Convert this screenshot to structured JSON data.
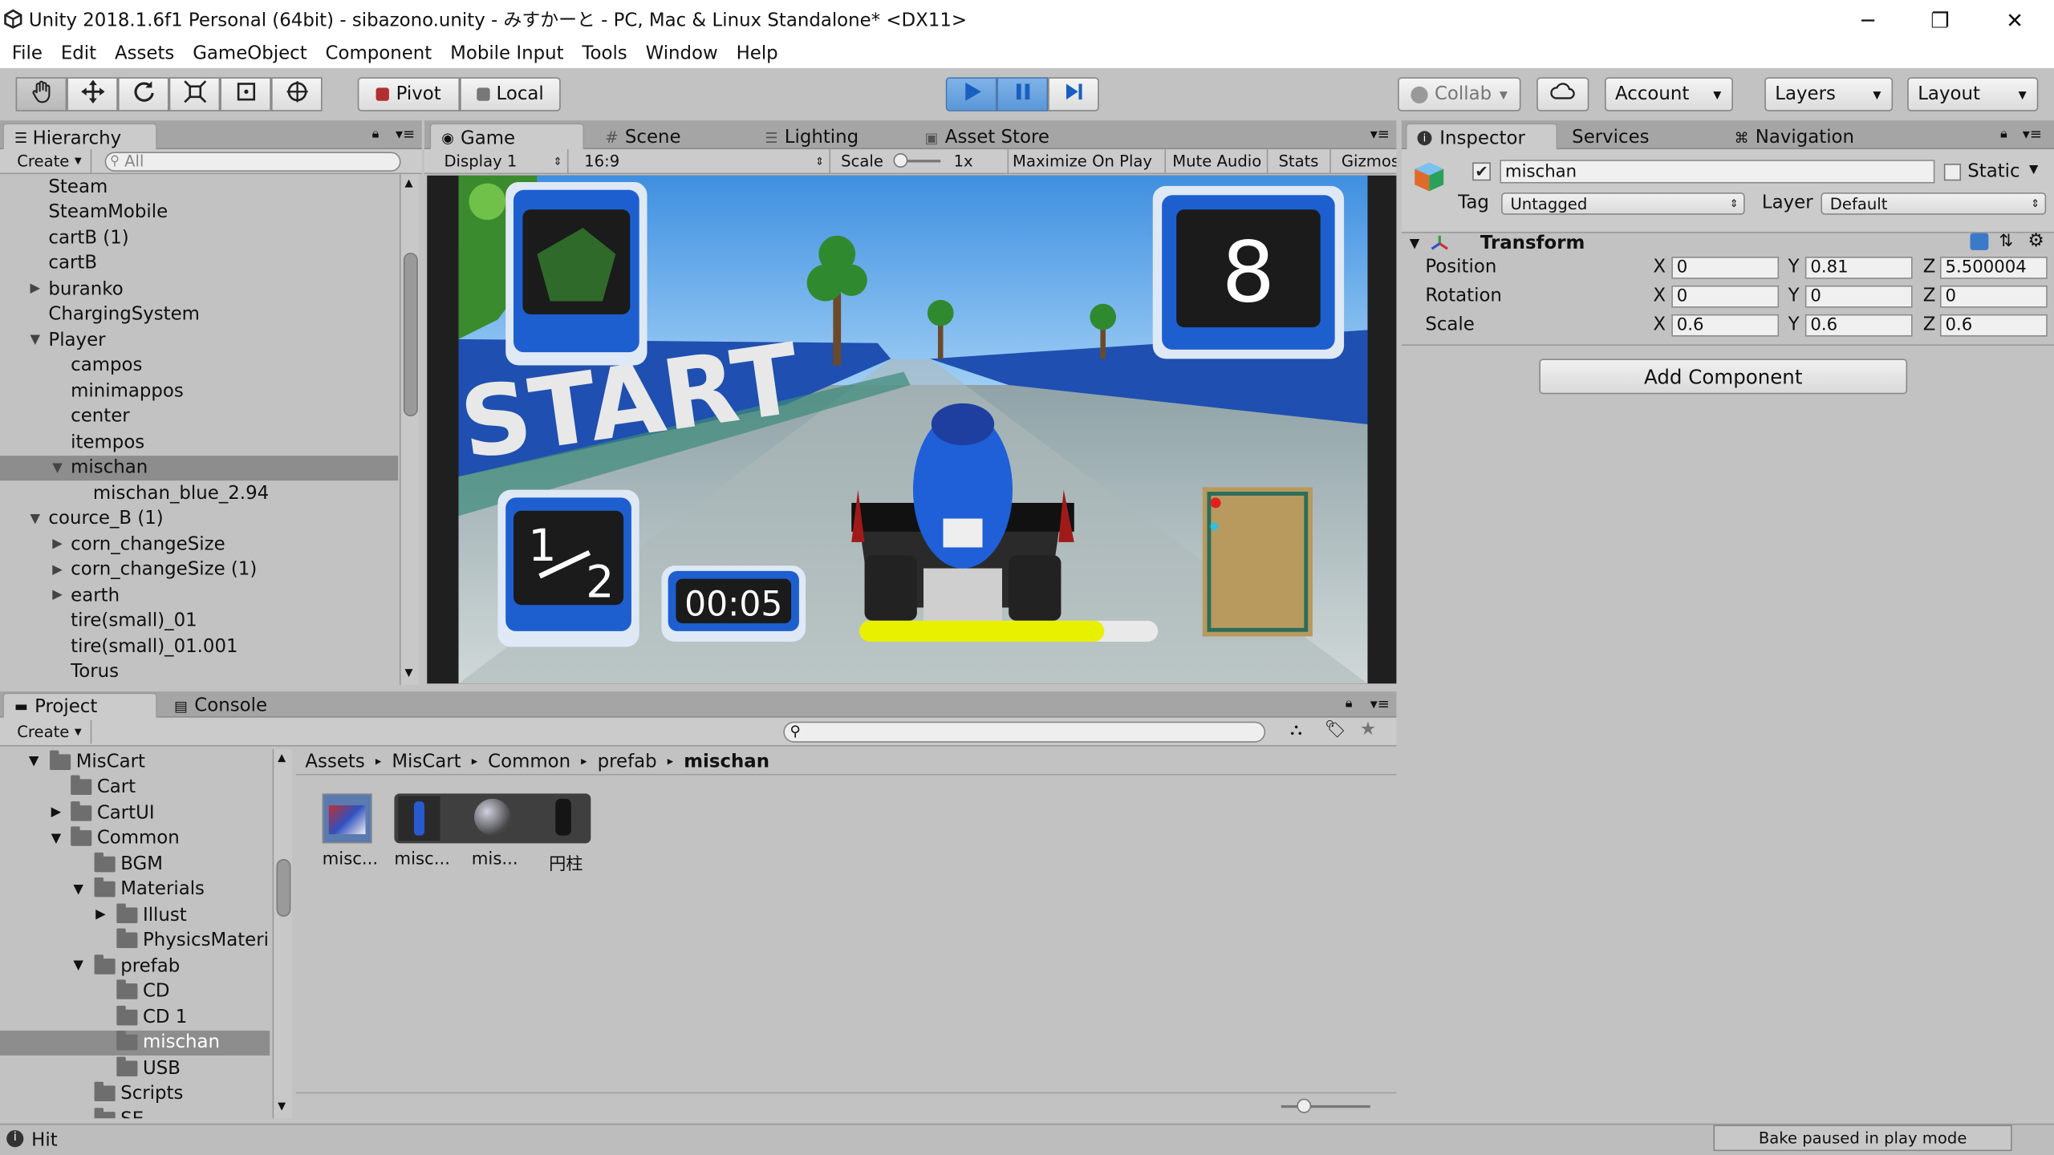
{
  "window": {
    "title": "Unity 2018.1.6f1 Personal (64bit) - sibazono.unity - みすかーと - PC, Mac & Linux Standalone* <DX11>",
    "minimize": "─",
    "maximize": "❐",
    "close": "✕"
  },
  "menu": [
    "File",
    "Edit",
    "Assets",
    "GameObject",
    "Component",
    "Mobile Input",
    "Tools",
    "Window",
    "Help"
  ],
  "toolbar": {
    "pivot": "Pivot",
    "local": "Local",
    "collab": "Collab",
    "account": "Account",
    "layers": "Layers",
    "layout": "Layout"
  },
  "hierarchy": {
    "tab": "Hierarchy",
    "create": "Create",
    "search_placeholder": "All",
    "rows": [
      "Steam",
      "SteamMobile",
      "cartB (1)",
      "cartB",
      "buranko",
      "ChargingSystem",
      "Player",
      "campos",
      "minimappos",
      "center",
      "itempos",
      "mischan",
      "mischan_blue_2.94",
      "cource_B (1)",
      "corn_changeSize",
      "corn_changeSize (1)",
      "earth",
      "tire(small)_01",
      "tire(small)_01.001",
      "Torus"
    ]
  },
  "game": {
    "tabs": [
      "Game",
      "Scene",
      "Lighting",
      "Asset Store"
    ],
    "display": "Display 1",
    "aspect": "16:9",
    "scale_label": "Scale",
    "scale_value": "1x",
    "maximize": "Maximize On Play",
    "mute": "Mute Audio",
    "stats": "Stats",
    "gizmos": "Gizmos",
    "hud": {
      "rank": "8",
      "lap": "1/2",
      "lap_num": "1",
      "lap_den": "2",
      "time": "00:05",
      "banner": "START",
      "boost_fraction": 0.82
    }
  },
  "inspector": {
    "tabs": [
      "Inspector",
      "Services",
      "Navigation"
    ],
    "name": "mischan",
    "static": "Static",
    "tag_label": "Tag",
    "tag": "Untagged",
    "layer_label": "Layer",
    "layer": "Default",
    "transform": "Transform",
    "position_label": "Position",
    "rotation_label": "Rotation",
    "scale_label": "Scale",
    "position": {
      "x": "0",
      "y": "0.81",
      "z": "5.500004"
    },
    "rotation": {
      "x": "0",
      "y": "0",
      "z": "0"
    },
    "scale": {
      "x": "0.6",
      "y": "0.6",
      "z": "0.6"
    },
    "axis": {
      "x": "X",
      "y": "Y",
      "z": "Z"
    },
    "add_component": "Add Component"
  },
  "project": {
    "tabs": [
      "Project",
      "Console"
    ],
    "create": "Create",
    "tree": [
      "MisCart",
      "Cart",
      "CartUI",
      "Common",
      "BGM",
      "Materials",
      "Illust",
      "PhysicsMateri",
      "prefab",
      "CD",
      "CD 1",
      "mischan",
      "USB",
      "Scripts",
      "SE"
    ],
    "breadcrumb": [
      "Assets",
      "MisCart",
      "Common",
      "prefab",
      "mischan"
    ],
    "assets": [
      "misc...",
      "misc...",
      "mis...",
      "円柱"
    ]
  },
  "status": {
    "message": "Hit",
    "bake": "Bake paused in play mode"
  },
  "colors": {
    "accent": "#3b7ddd",
    "panel": "#c2c2c2",
    "tabstrip": "#a5a5a5",
    "hud_blue": "#1e5fd0",
    "boost": "#e8f000"
  }
}
